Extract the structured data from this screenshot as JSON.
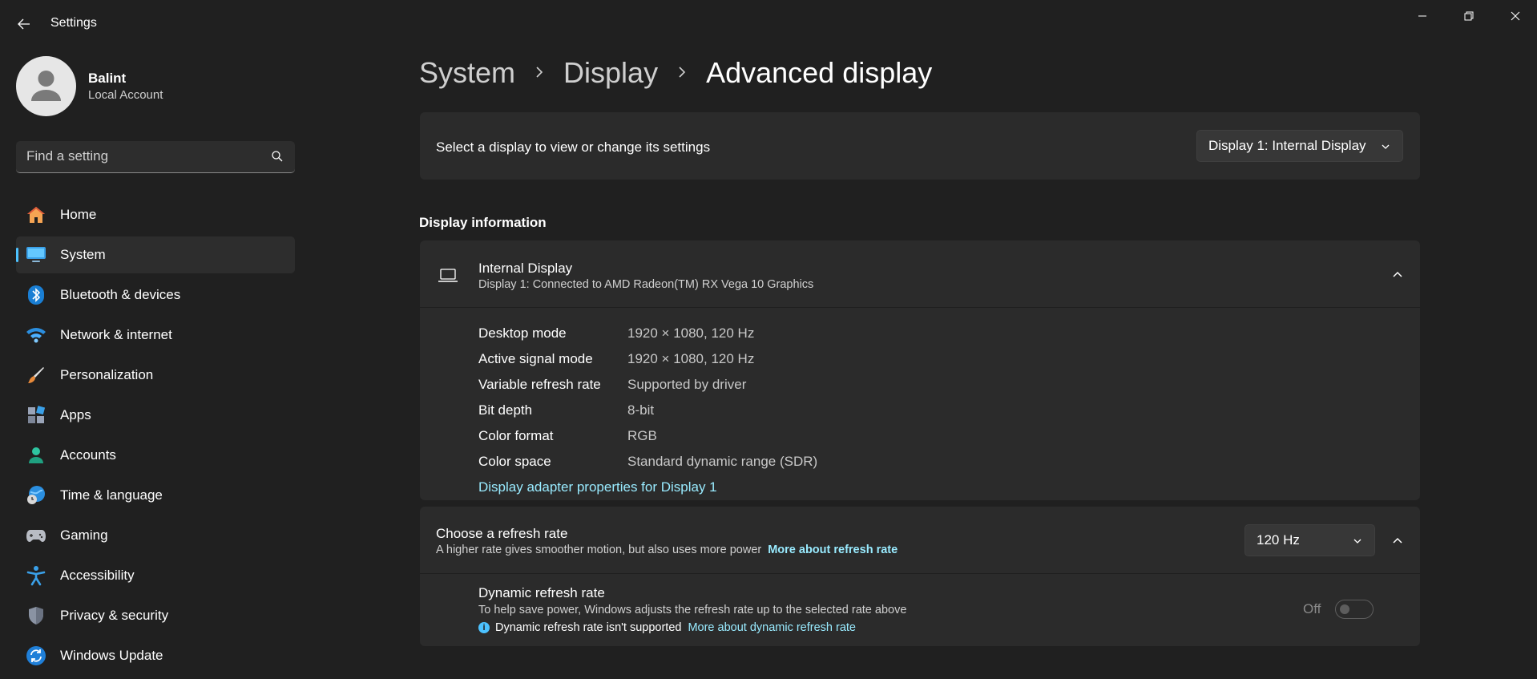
{
  "window": {
    "title": "Settings",
    "controls": [
      "minimize-icon",
      "restore-icon",
      "close-icon"
    ]
  },
  "profile": {
    "name": "Balint",
    "account_type": "Local Account"
  },
  "search": {
    "placeholder": "Find a setting"
  },
  "sidebar": {
    "items": [
      {
        "label": "Home",
        "icon": "home-icon",
        "active": false
      },
      {
        "label": "System",
        "icon": "system-monitor-icon",
        "active": true
      },
      {
        "label": "Bluetooth & devices",
        "icon": "bluetooth-icon",
        "active": false
      },
      {
        "label": "Network & internet",
        "icon": "wifi-icon",
        "active": false
      },
      {
        "label": "Personalization",
        "icon": "paintbrush-icon",
        "active": false
      },
      {
        "label": "Apps",
        "icon": "apps-icon",
        "active": false
      },
      {
        "label": "Accounts",
        "icon": "accounts-icon",
        "active": false
      },
      {
        "label": "Time & language",
        "icon": "globe-clock-icon",
        "active": false
      },
      {
        "label": "Gaming",
        "icon": "gamepad-icon",
        "active": false
      },
      {
        "label": "Accessibility",
        "icon": "accessibility-icon",
        "active": false
      },
      {
        "label": "Privacy & security",
        "icon": "shield-icon",
        "active": false
      },
      {
        "label": "Windows Update",
        "icon": "update-icon",
        "active": false
      }
    ]
  },
  "breadcrumb": {
    "items": [
      "System",
      "Display"
    ],
    "current": "Advanced display"
  },
  "display_select": {
    "label": "Select a display to view or change its settings",
    "value": "Display 1: Internal Display"
  },
  "display_info": {
    "section_title": "Display information",
    "title": "Internal Display",
    "subtitle": "Display 1: Connected to AMD Radeon(TM) RX Vega 10 Graphics",
    "rows": [
      {
        "label": "Desktop mode",
        "value": "1920 × 1080, 120 Hz"
      },
      {
        "label": "Active signal mode",
        "value": "1920 × 1080, 120 Hz"
      },
      {
        "label": "Variable refresh rate",
        "value": "Supported by driver"
      },
      {
        "label": "Bit depth",
        "value": "8-bit"
      },
      {
        "label": "Color format",
        "value": "RGB"
      },
      {
        "label": "Color space",
        "value": "Standard dynamic range (SDR)"
      }
    ],
    "adapter_link": "Display adapter properties for Display 1"
  },
  "refresh_rate": {
    "title": "Choose a refresh rate",
    "subtitle": "A higher rate gives smoother motion, but also uses more power",
    "link": "More about refresh rate",
    "value": "120 Hz",
    "dynamic": {
      "title": "Dynamic refresh rate",
      "subtitle": "To help save power, Windows adjusts the refresh rate up to the selected rate above",
      "note": "Dynamic refresh rate isn't supported",
      "link": "More about dynamic refresh rate",
      "toggle_label": "Off"
    }
  },
  "colors": {
    "background": "#202020",
    "card": "#2b2b2b",
    "accent": "#4cc2ff",
    "link": "#99ebff"
  }
}
